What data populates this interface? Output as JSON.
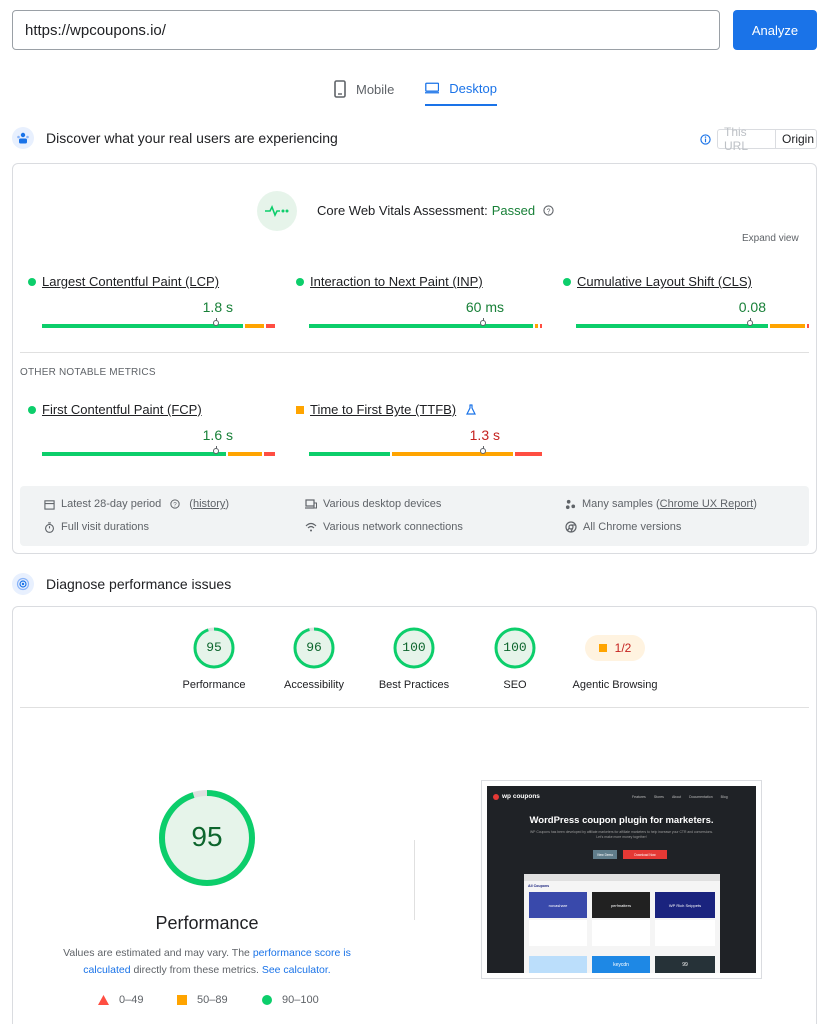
{
  "search": {
    "url_value": "https://wpcoupons.io/",
    "analyze_label": "Analyze"
  },
  "tabs": [
    {
      "label": "Mobile"
    },
    {
      "label": "Desktop"
    }
  ],
  "field": {
    "title": "Discover what your real users are experiencing",
    "toggle": {
      "this_url": "This URL",
      "origin": "Origin"
    },
    "assessment_label": "Core Web Vitals Assessment:",
    "assessment_status": "Passed",
    "expand_label": "Expand view",
    "metrics": [
      {
        "name": "Largest Contentful Paint (LCP)",
        "value": "1.8 s",
        "status": "good"
      },
      {
        "name": "Interaction to Next Paint (INP)",
        "value": "60 ms",
        "status": "good"
      },
      {
        "name": "Cumulative Layout Shift (CLS)",
        "value": "0.08",
        "status": "good"
      }
    ],
    "other_heading": "OTHER NOTABLE METRICS",
    "other_metrics": [
      {
        "name": "First Contentful Paint (FCP)",
        "value": "1.6 s",
        "status": "good"
      },
      {
        "name": "Time to First Byte (TTFB)",
        "value": "1.3 s",
        "status": "needs-improvement"
      }
    ],
    "info": {
      "period_label": "Latest 28-day period",
      "history_link": "history",
      "devices": "Various desktop devices",
      "samples_prefix": "Many samples (",
      "samples_link": "Chrome UX Report",
      "samples_suffix": ")",
      "durations": "Full visit durations",
      "connections": "Various network connections",
      "chrome_versions": "All Chrome versions"
    }
  },
  "diagnose": {
    "title": "Diagnose performance issues",
    "categories": [
      {
        "score": "95",
        "label": "Performance"
      },
      {
        "score": "96",
        "label": "Accessibility"
      },
      {
        "score": "100",
        "label": "Best Practices"
      },
      {
        "score": "100",
        "label": "SEO"
      }
    ],
    "agentic": {
      "score": "1/2",
      "label": "Agentic Browsing"
    },
    "perf_score": "95",
    "perf_label": "Performance",
    "note_prefix": "Values are estimated and may vary. The ",
    "note_link1": "performance score is calculated",
    "note_mid": " directly from these metrics. ",
    "note_link2": "See calculator.",
    "legend": [
      {
        "range": "0–49"
      },
      {
        "range": "50–89"
      },
      {
        "range": "90–100"
      }
    ]
  },
  "screenshot": {
    "brand": "wp coupons",
    "nav": [
      "Features",
      "Stores",
      "About",
      "Documentation",
      "Blog"
    ],
    "headline": "WordPress coupon plugin for marketers.",
    "subtext": "WP Coupons has been developed by affiliate marketers for affiliate marketers to help increase your CTR and conversions. Let's make more money together!",
    "btn_primary": "View Demo",
    "btn_secondary": "Download Now",
    "inner_heading": "All Coupons",
    "tiles": [
      "novashare",
      "perfmatters",
      "WP Rich Snippets",
      "",
      "keycdn",
      "99"
    ]
  },
  "colors": {
    "good": "#0cce6b",
    "average": "#ffa400",
    "poor": "#ff4e42",
    "accent": "#1a73e8"
  }
}
